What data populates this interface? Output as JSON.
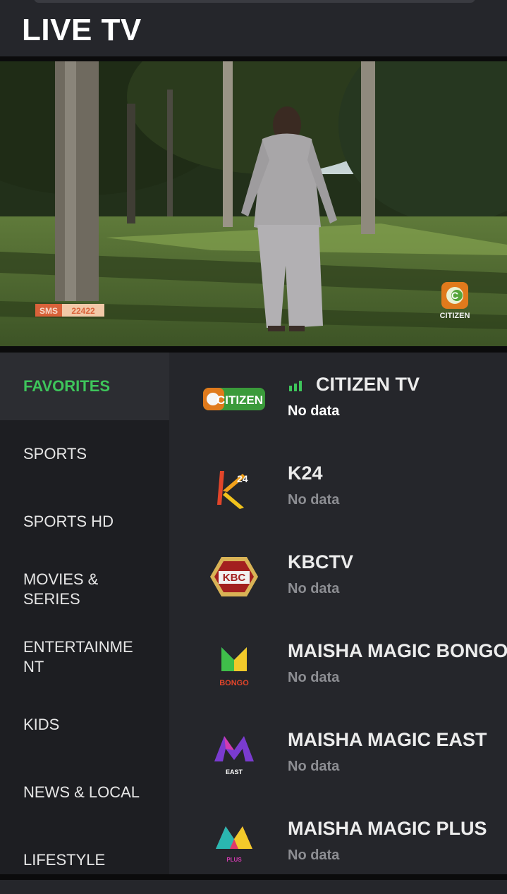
{
  "header": {
    "title": "LIVE TV"
  },
  "video": {
    "bug_sms_label": "SMS",
    "bug_sms_number": "22422",
    "watermark_text": "CITIZEN",
    "watermark_letter": "C"
  },
  "sidebar": {
    "categories": [
      {
        "label": "FAVORITES",
        "active": true
      },
      {
        "label": "SPORTS"
      },
      {
        "label": "SPORTS HD"
      },
      {
        "label": "MOVIES & SERIES"
      },
      {
        "label": "ENTERTAINMENT"
      },
      {
        "label": "KIDS"
      },
      {
        "label": "NEWS & LOCAL"
      },
      {
        "label": "LIFESTYLE"
      }
    ]
  },
  "channels": [
    {
      "name": "CITIZEN TV",
      "status": "No data",
      "logo": "citizen-logo",
      "logo_text": "CITIZEN",
      "live": true
    },
    {
      "name": "K24",
      "status": "No data",
      "logo": "k24-logo",
      "logo_text": "24"
    },
    {
      "name": "KBCTV",
      "status": "No data",
      "logo": "kbc-logo",
      "logo_text": "KBC"
    },
    {
      "name": "MAISHA MAGIC BONGO",
      "status": "No data",
      "logo": "maisha-magic-bongo-logo",
      "logo_text": "BONGO"
    },
    {
      "name": "MAISHA MAGIC EAST",
      "status": "No data",
      "logo": "maisha-magic-east-logo",
      "logo_text": "EAST"
    },
    {
      "name": "MAISHA MAGIC PLUS",
      "status": "No data",
      "logo": "maisha-magic-plus-logo",
      "logo_text": "PLUS"
    }
  ],
  "colors": {
    "accent_green": "#3ec55b",
    "background": "#25262b",
    "sidebar": "#1d1e22",
    "muted_text": "#8d8e93"
  }
}
